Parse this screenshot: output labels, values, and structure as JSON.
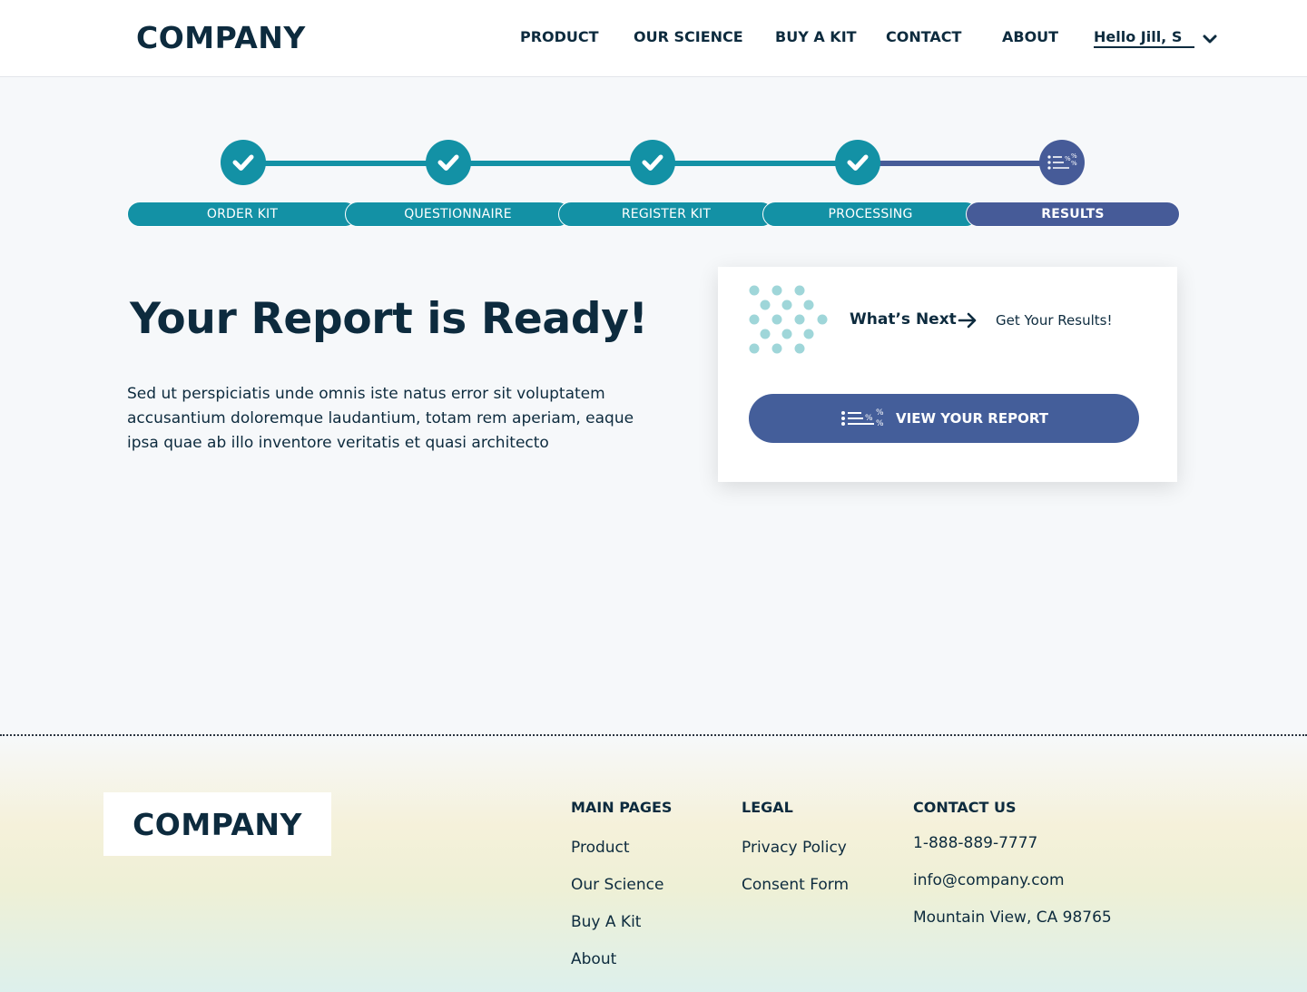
{
  "header": {
    "logo": "COMPANY",
    "nav": [
      "PRODUCT",
      "OUR SCIENCE",
      "BUY A KIT",
      "CONTACT",
      "ABOUT"
    ],
    "user": "Hello Jill, S"
  },
  "stepper": {
    "steps": [
      {
        "label": "ORDER KIT",
        "status": "complete"
      },
      {
        "label": "QUESTIONNAIRE",
        "status": "complete"
      },
      {
        "label": "REGISTER KIT",
        "status": "complete"
      },
      {
        "label": "PROCESSING",
        "status": "complete"
      },
      {
        "label": "RESULTS",
        "status": "current"
      }
    ],
    "colors": {
      "complete": "#1391a5",
      "current": "#465b98"
    }
  },
  "main": {
    "headline": "Your Report is Ready!",
    "body": "Sed ut perspiciatis unde omnis iste natus error sit voluptatem accusantium doloremque laudantium, totam rem aperiam, eaque ipsa quae ab illo inventore veritatis et quasi architecto"
  },
  "card": {
    "whats_next": "What’s Next",
    "get_results": "Get Your Results!",
    "button_label": "VIEW YOUR REPORT",
    "button_color": "#445e9a"
  },
  "footer": {
    "logo": "COMPANY",
    "main_pages": {
      "heading": "MAIN PAGES",
      "links": [
        "Product",
        "Our Science",
        "Buy A Kit",
        "About"
      ]
    },
    "legal": {
      "heading": "LEGAL",
      "links": [
        "Privacy Policy",
        "Consent Form"
      ]
    },
    "contact": {
      "heading": "CONTACT US",
      "phone": "1-888-889-7777",
      "email": "info@company.com",
      "address": "Mountain View, CA 98765"
    }
  }
}
